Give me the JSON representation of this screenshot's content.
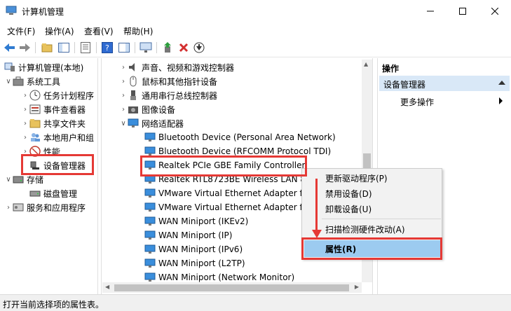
{
  "window": {
    "title": "计算机管理"
  },
  "menu": [
    "文件(F)",
    "操作(A)",
    "查看(V)",
    "帮助(H)"
  ],
  "left_tree": {
    "root": "计算机管理(本地)",
    "system_tools": "系统工具",
    "items": [
      "任务计划程序",
      "事件查看器",
      "共享文件夹",
      "本地用户和组",
      "性能",
      "设备管理器"
    ],
    "storage": "存储",
    "disk_management": "磁盘管理",
    "services": "服务和应用程序"
  },
  "device_tree": {
    "categories": [
      "声音、视频和游戏控制器",
      "鼠标和其他指针设备",
      "通用串行总线控制器",
      "图像设备",
      "网络适配器"
    ],
    "network_adapters": [
      "Bluetooth Device (Personal Area Network)",
      "Bluetooth Device (RFCOMM Protocol TDI)",
      "Realtek PCIe GBE Family Controller",
      "Realtek RTL8723BE Wireless LAN 8",
      "VMware Virtual Ethernet Adapter fo",
      "VMware Virtual Ethernet Adapter fo",
      "WAN Miniport (IKEv2)",
      "WAN Miniport (IP)",
      "WAN Miniport (IPv6)",
      "WAN Miniport (L2TP)",
      "WAN Miniport (Network Monitor)"
    ]
  },
  "actions": {
    "header": "操作",
    "section": "设备管理器",
    "more": "更多操作"
  },
  "context_menu": {
    "items": [
      "更新驱动程序(P)",
      "禁用设备(D)",
      "卸载设备(U)",
      "扫描检测硬件改动(A)",
      "属性(R)"
    ]
  },
  "status": {
    "text": "打开当前选择项的属性表。"
  },
  "colors": {
    "annotation_red": "#e53935",
    "selection_blue": "#9ccbf0",
    "section_blue": "#d9e8f7"
  }
}
